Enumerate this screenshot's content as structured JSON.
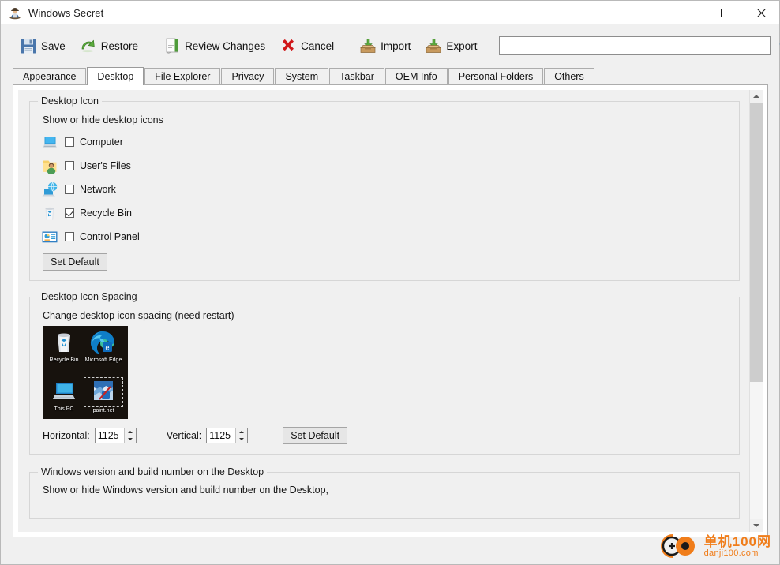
{
  "window": {
    "title": "Windows Secret",
    "icon": "app-person-icon",
    "minimize_label": "Minimize",
    "maximize_label": "Maximize",
    "close_label": "Close"
  },
  "toolbar": {
    "items": [
      {
        "label": "Save",
        "icon": "floppy-disk-icon"
      },
      {
        "label": "Restore",
        "icon": "undo-arrow-icon"
      },
      {
        "label": "Review Changes",
        "icon": "document-list-icon"
      },
      {
        "label": "Cancel",
        "icon": "red-x-icon"
      },
      {
        "label": "Import",
        "icon": "import-box-icon"
      },
      {
        "label": "Export",
        "icon": "export-box-icon"
      }
    ],
    "search": {
      "value": "",
      "placeholder": "",
      "button_icon": "magnifier-icon"
    }
  },
  "tabs": [
    {
      "label": "Appearance",
      "active": false
    },
    {
      "label": "Desktop",
      "active": true
    },
    {
      "label": "File Explorer",
      "active": false
    },
    {
      "label": "Privacy",
      "active": false
    },
    {
      "label": "System",
      "active": false
    },
    {
      "label": "Taskbar",
      "active": false
    },
    {
      "label": "OEM Info",
      "active": false
    },
    {
      "label": "Personal Folders",
      "active": false
    },
    {
      "label": "Others",
      "active": false
    }
  ],
  "desktop_icon_group": {
    "title": "Desktop Icon",
    "description": "Show or hide desktop icons",
    "items": [
      {
        "label": "Computer",
        "checked": false,
        "icon": "computer-icon"
      },
      {
        "label": "User's Files",
        "checked": false,
        "icon": "user-folder-icon"
      },
      {
        "label": "Network",
        "checked": false,
        "icon": "network-icon"
      },
      {
        "label": "Recycle Bin",
        "checked": true,
        "icon": "recycle-bin-icon"
      },
      {
        "label": "Control Panel",
        "checked": false,
        "icon": "control-panel-icon"
      }
    ],
    "set_default_label": "Set Default"
  },
  "spacing_group": {
    "title": "Desktop Icon Spacing",
    "description": "Change desktop icon spacing  (need restart)",
    "preview_icons": [
      {
        "label": "Recycle Bin",
        "icon": "recycle-bin-icon",
        "selected": false
      },
      {
        "label": "Microsoft Edge",
        "icon": "edge-icon",
        "selected": false
      },
      {
        "label": "This PC",
        "icon": "this-pc-icon",
        "selected": false
      },
      {
        "label": "paint.net",
        "icon": "paint-net-icon",
        "selected": true
      }
    ],
    "horizontal_label": "Horizontal:",
    "horizontal_value": "1125",
    "vertical_label": "Vertical:",
    "vertical_value": "1125",
    "set_default_label": "Set Default"
  },
  "version_group": {
    "title": "Windows version and build number on the Desktop",
    "description": "Show or hide Windows version and build number on the Desktop,"
  },
  "scrollbar": {
    "up_icon": "chevron-up-icon",
    "down_icon": "chevron-down-icon"
  },
  "watermark": {
    "chinese": "单机100网",
    "english": "danji100.com",
    "color": "#f07d1a"
  },
  "colors": {
    "window_bg": "#f0f0f0",
    "panel_bg": "#ffffff",
    "accent": "#0078d7",
    "text": "#111111"
  }
}
